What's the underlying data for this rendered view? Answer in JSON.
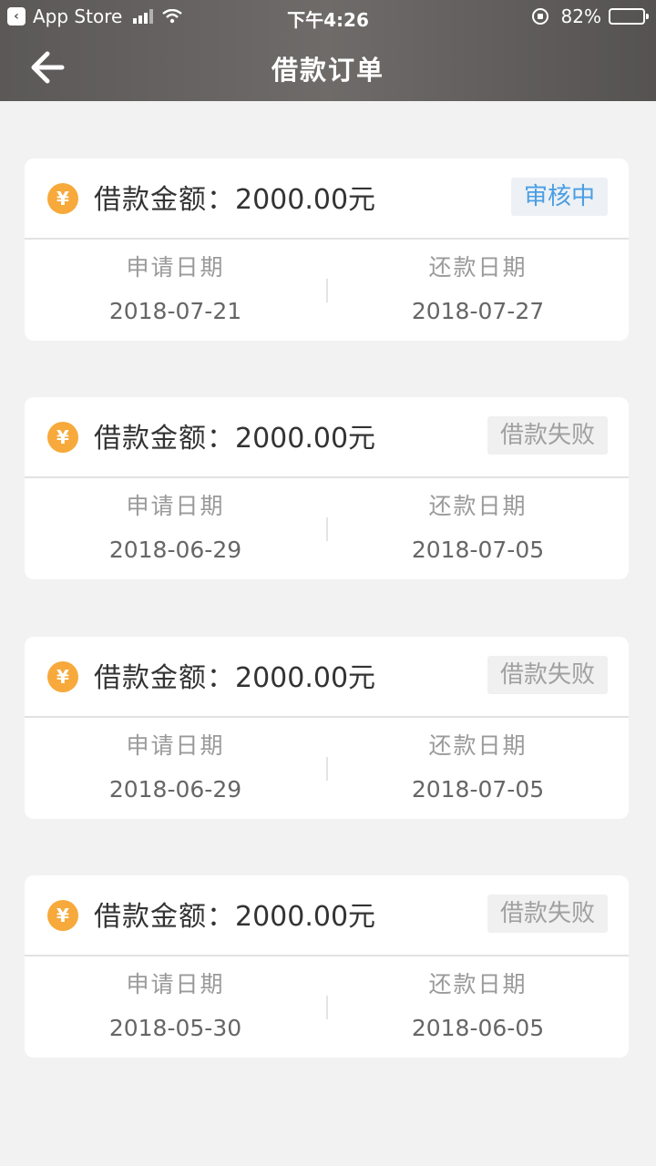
{
  "status_bar": {
    "back_app_label": "App Store",
    "time": "下午4:26",
    "battery": "82%",
    "battery_level": 0.82
  },
  "navbar": {
    "title": "借款订单",
    "back_icon": "arrow-left-icon"
  },
  "orders": [
    {
      "amount_label": "借款金额：",
      "amount": "2000.00元",
      "status": "审核中",
      "apply_label": "申请日期",
      "apply_date": "2018-07-21",
      "repay_label": "还款日期",
      "repay_date": "2018-07-27"
    },
    {
      "amount_label": "借款金额：",
      "amount": "2000.00元",
      "status": "借款失败",
      "apply_label": "申请日期",
      "apply_date": "2018-06-29",
      "repay_label": "还款日期",
      "repay_date": "2018-07-05"
    },
    {
      "amount_label": "借款金额：",
      "amount": "2000.00元",
      "status": "借款失败",
      "apply_label": "申请日期",
      "apply_date": "2018-06-29",
      "repay_label": "还款日期",
      "repay_date": "2018-07-05"
    },
    {
      "amount_label": "借款金额：",
      "amount": "2000.00元",
      "status": "借款失败",
      "apply_label": "申请日期",
      "apply_date": "2018-05-30",
      "repay_label": "还款日期",
      "repay_date": "2018-06-05"
    }
  ],
  "icons": {
    "currency": "yuan-icon",
    "back": "arrow-left-icon"
  },
  "colors": {
    "review": "#4a9ee3",
    "fail": "#a0a0a0",
    "yuan": "#f7a93b"
  }
}
